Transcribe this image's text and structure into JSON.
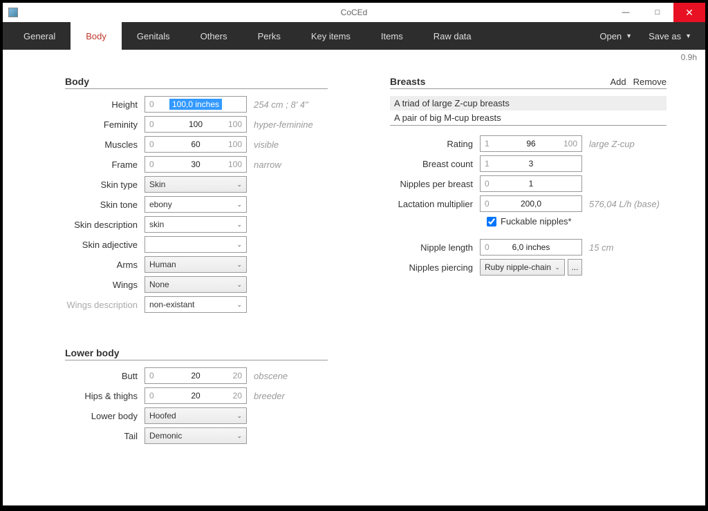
{
  "app": {
    "title": "CoCEd",
    "version": "0.9h"
  },
  "winbtns": {
    "min": "—",
    "max": "□",
    "close": "✕"
  },
  "tabs": [
    "General",
    "Body",
    "Genitals",
    "Others",
    "Perks",
    "Key items",
    "Items",
    "Raw data"
  ],
  "menuactions": {
    "open": "Open",
    "saveas": "Save as"
  },
  "sections": {
    "body": "Body",
    "lowerbody": "Lower body",
    "breasts": "Breasts"
  },
  "breastActions": {
    "add": "Add",
    "remove": "Remove"
  },
  "body": {
    "height": {
      "label": "Height",
      "lo": "0",
      "val": "100,0 inches",
      "hi": "",
      "hint": "254 cm ; 8' 4\""
    },
    "feminity": {
      "label": "Feminity",
      "lo": "0",
      "val": "100",
      "hi": "100",
      "hint": "hyper-feminine"
    },
    "muscles": {
      "label": "Muscles",
      "lo": "0",
      "val": "60",
      "hi": "100",
      "hint": "visible"
    },
    "frame": {
      "label": "Frame",
      "lo": "0",
      "val": "30",
      "hi": "100",
      "hint": "narrow"
    },
    "skintype": {
      "label": "Skin type",
      "val": "Skin"
    },
    "skintone": {
      "label": "Skin tone",
      "val": "ebony"
    },
    "skindesc": {
      "label": "Skin description",
      "val": "skin"
    },
    "skinadj": {
      "label": "Skin adjective",
      "val": ""
    },
    "arms": {
      "label": "Arms",
      "val": "Human"
    },
    "wings": {
      "label": "Wings",
      "val": "None"
    },
    "wingsdesc": {
      "label": "Wings description",
      "val": "non-existant"
    }
  },
  "lowerbody": {
    "butt": {
      "label": "Butt",
      "lo": "0",
      "val": "20",
      "hi": "20",
      "hint": "obscene"
    },
    "hips": {
      "label": "Hips & thighs",
      "lo": "0",
      "val": "20",
      "hi": "20",
      "hint": "breeder"
    },
    "lbtype": {
      "label": "Lower body",
      "val": "Hoofed"
    },
    "tail": {
      "label": "Tail",
      "val": "Demonic"
    }
  },
  "breastsList": [
    "A triad of large Z-cup breasts",
    "A pair of big M-cup breasts"
  ],
  "breasts": {
    "rating": {
      "label": "Rating",
      "lo": "1",
      "val": "96",
      "hi": "100",
      "hint": "large Z-cup"
    },
    "count": {
      "label": "Breast count",
      "lo": "1",
      "val": "3",
      "hi": ""
    },
    "npb": {
      "label": "Nipples per breast",
      "lo": "0",
      "val": "1",
      "hi": ""
    },
    "lact": {
      "label": "Lactation multiplier",
      "lo": "0",
      "val": "200,0",
      "hi": "",
      "hint": "576,04 L/h (base)"
    },
    "fuckable": {
      "label": "Fuckable nipples*"
    },
    "niplen": {
      "label": "Nipple length",
      "lo": "0",
      "val": "6,0 inches",
      "hi": "",
      "hint": "15 cm"
    },
    "piercing": {
      "label": "Nipples piercing",
      "val": "Ruby nipple-chain",
      "btn": "..."
    }
  }
}
